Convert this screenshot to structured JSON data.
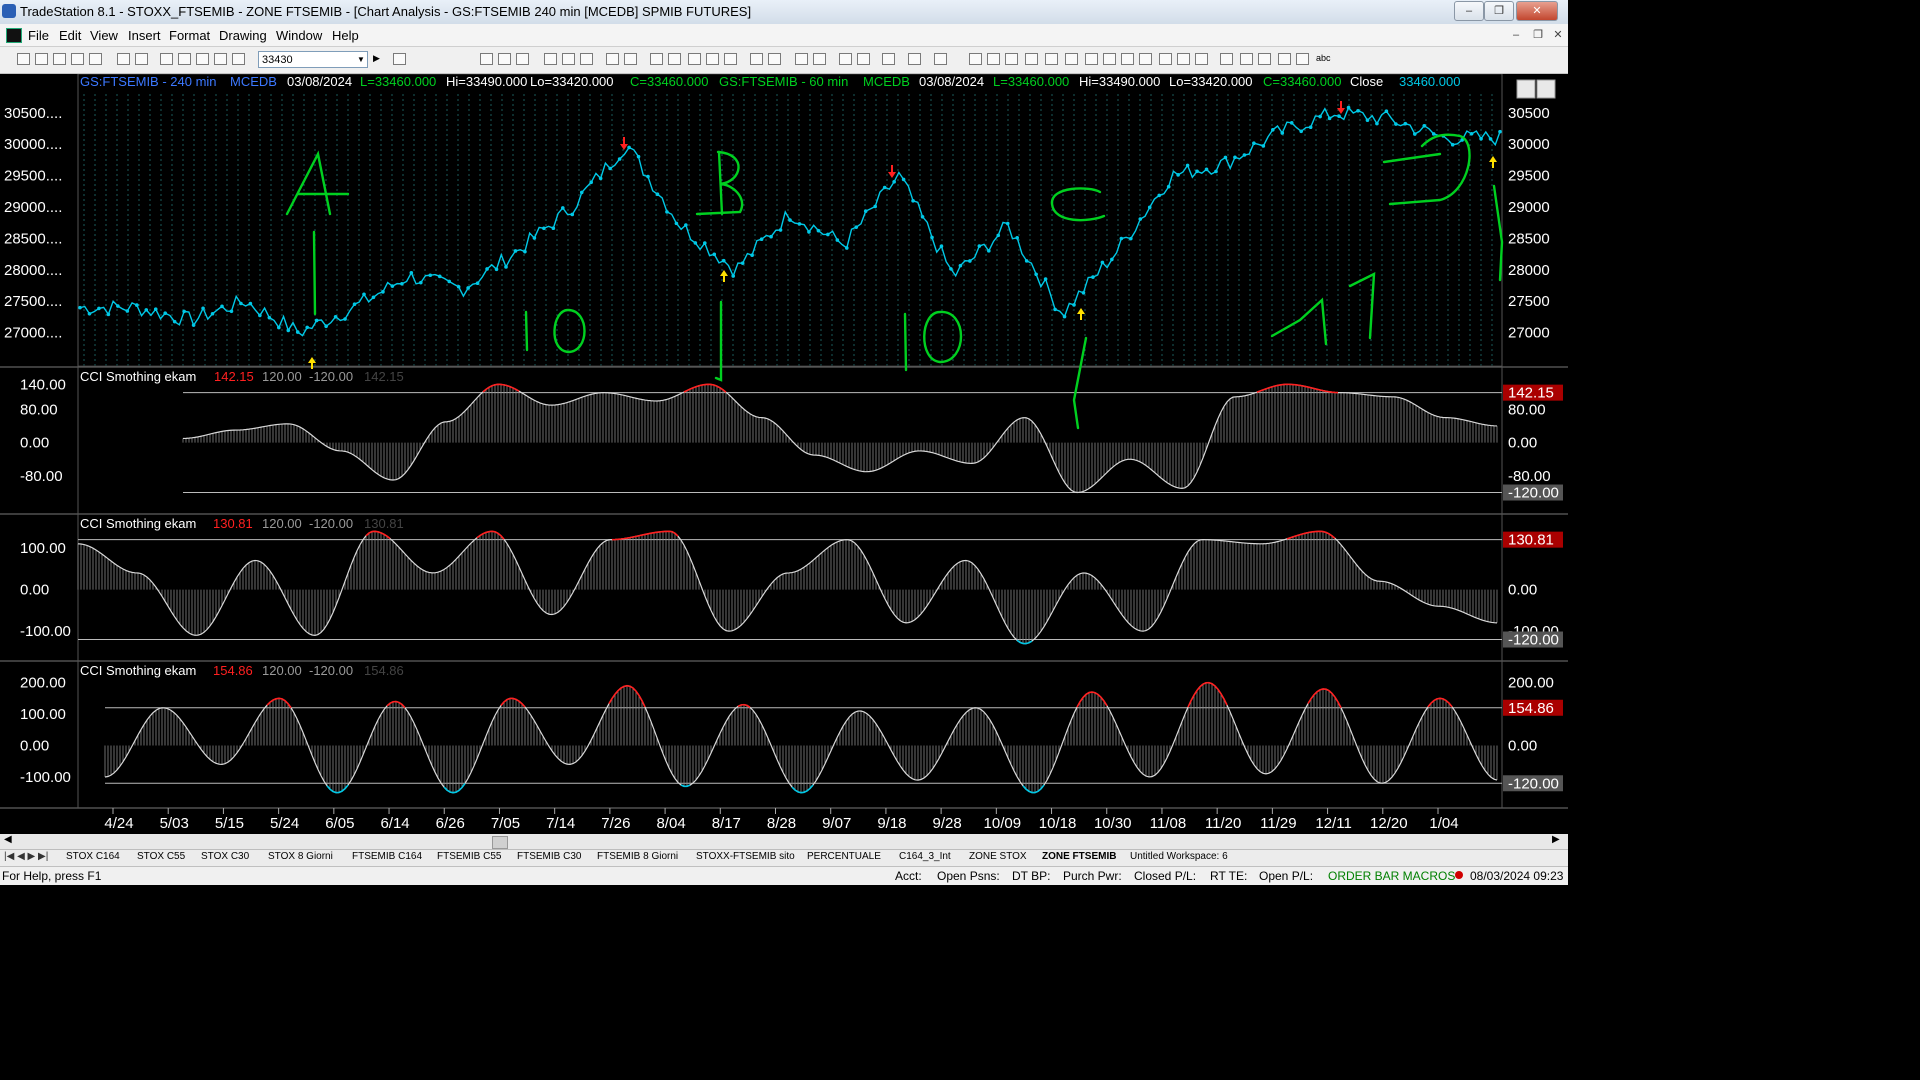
{
  "window": {
    "title": "TradeStation 8.1 - STOXX_FTSEMIB - ZONE FTSEMIB - [Chart Analysis - GS:FTSEMIB  240 min  [MCEDB] SPMIB FUTURES]",
    "min": "–",
    "max": "❐",
    "close": "✕"
  },
  "menu": [
    "File",
    "Edit",
    "View",
    "Insert",
    "Format",
    "Drawing",
    "Window",
    "Help"
  ],
  "toolbar": {
    "symbol_value": "33430"
  },
  "price_header": {
    "sym1": "GS:FTSEMIB - 240 min",
    "db1": "MCEDB",
    "date1": "03/08/2024",
    "l1": "L=33460.000",
    "h1": "Hi=33490.000",
    "lo1": "Lo=33420.000",
    "c1": "C=33460.000",
    "sym2": "GS:FTSEMIB - 60 min",
    "db2": "MCEDB",
    "date2": "03/08/2024",
    "l2": "L=33460.000",
    "h2": "Hi=33490.000",
    "lo2": "Lo=33420.000",
    "c2": "C=33460.000",
    "close_label": "Close",
    "close_val": "33460.000"
  },
  "price_axis": {
    "left": [
      "30500....",
      "30000....",
      "29500....",
      "29000....",
      "28500....",
      "28000....",
      "27500....",
      "27000...."
    ],
    "right": [
      "30500",
      "30000",
      "29500",
      "29000",
      "28500",
      "28000",
      "27500",
      "27000"
    ],
    "values": [
      30500,
      30000,
      29500,
      29000,
      28500,
      28000,
      27500,
      27000
    ]
  },
  "cci_panels": [
    {
      "name": "CCI Smothing ekam",
      "v": "142.15",
      "up": "120.00",
      "dn": "-120.00",
      "ghost": "142.15",
      "axis": [
        "140.00",
        "80.00",
        "0.00",
        "-80.00"
      ],
      "axis_vals": [
        140,
        80,
        0,
        -80
      ],
      "right": [
        "142.15",
        "80.00",
        "0.00",
        "-80.00",
        "-120.00"
      ],
      "right_vals": [
        120,
        80,
        0,
        -80,
        -120
      ]
    },
    {
      "name": "CCI Smothing ekam",
      "v": "130.81",
      "up": "120.00",
      "dn": "-120.00",
      "ghost": "130.81",
      "axis": [
        "100.00",
        "0.00",
        "-100.00"
      ],
      "axis_vals": [
        100,
        0,
        -100
      ],
      "right": [
        "130.81",
        "0.00",
        "-100.00",
        "-120.00"
      ],
      "right_vals": [
        120,
        0,
        -100,
        -120
      ]
    },
    {
      "name": "CCI Smothing ekam",
      "v": "154.86",
      "up": "120.00",
      "dn": "-120.00",
      "ghost": "154.86",
      "axis": [
        "200.00",
        "100.00",
        "0.00",
        "-100.00"
      ],
      "axis_vals": [
        200,
        100,
        0,
        -100
      ],
      "right": [
        "200.00",
        "154.86",
        "0.00",
        "-120.00"
      ],
      "right_vals": [
        200,
        120,
        0,
        -120
      ]
    }
  ],
  "date_axis": [
    "4/24",
    "5/03",
    "5/15",
    "5/24",
    "6/05",
    "6/14",
    "6/26",
    "7/05",
    "7/14",
    "7/26",
    "8/04",
    "8/17",
    "8/28",
    "9/07",
    "9/18",
    "9/28",
    "10/09",
    "10/18",
    "10/30",
    "11/08",
    "11/20",
    "11/29",
    "12/11",
    "12/20",
    "1/04"
  ],
  "annotations": {
    "a": "A",
    "b": "B",
    "c": "C",
    "d": "D",
    "n10a": "10",
    "n10b": "10",
    "n11": "11"
  },
  "workspace_tabs": [
    "STOX C164",
    "STOX C55",
    "STOX  C30",
    "STOX  8 Giorni",
    "FTSEMIB C164",
    "FTSEMIB C55",
    "FTSEMIB C30",
    "FTSEMIB  8 Giorni",
    "STOXX-FTSEMIB sito",
    "PERCENTUALE",
    "C164_3_Int",
    "ZONE STOX",
    "ZONE FTSEMIB",
    "Untitled Workspace:  6"
  ],
  "active_tab": "ZONE FTSEMIB",
  "status": {
    "help": "For Help, press F1",
    "acct": "Acct:",
    "open_psns": "Open Psns:",
    "dt_bp": "DT BP:",
    "purch_pwr": "Purch Pwr:",
    "closed_pl": "Closed P/L:",
    "rt_te": "RT TE:",
    "open_pl": "Open P/L:",
    "macros": "ORDER BAR  MACROS",
    "datetime": "08/03/2024 09:23"
  },
  "colors": {
    "price_line": "#00c8e6",
    "green_ink": "#00d020",
    "cci_pos_peak": "#ff2020",
    "cci_neg_trough": "#00c8e6",
    "header_blue": "#3c78ff",
    "header_green": "#00d020"
  },
  "chart_data": {
    "type": "line",
    "x": [
      "4/24",
      "5/03",
      "5/15",
      "5/24",
      "6/05",
      "6/14",
      "6/26",
      "7/05",
      "7/14",
      "7/26",
      "8/04",
      "8/17",
      "8/28",
      "9/07",
      "9/18",
      "9/28",
      "10/09",
      "10/18",
      "10/30",
      "11/08",
      "11/20",
      "11/29",
      "12/11",
      "12/20",
      "1/04"
    ],
    "series": [
      {
        "values": [
          27400,
          27200,
          27500,
          27000,
          27400,
          27900,
          27700,
          28300,
          29000,
          30000,
          28700,
          28000,
          28900,
          28400,
          29500,
          27900,
          28700,
          27300,
          28300,
          29500,
          29700,
          30200,
          30500,
          30400,
          30100
        ]
      }
    ],
    "ylim": [
      26500,
      30800
    ],
    "cci": [
      {
        "name": "CCI Smothing ekam",
        "last": 142.15,
        "bands": [
          120,
          -120
        ],
        "values": [
          10,
          30,
          45,
          -20,
          -90,
          50,
          140,
          90,
          120,
          100,
          140,
          60,
          -30,
          -70,
          -20,
          -50,
          60,
          -120,
          -40,
          -110,
          110,
          140,
          120,
          110,
          60,
          40
        ]
      },
      {
        "name": "CCI Smothing ekam",
        "last": 130.81,
        "bands": [
          120,
          -120
        ],
        "values": [
          110,
          40,
          -110,
          70,
          -110,
          140,
          40,
          140,
          -60,
          120,
          140,
          -100,
          40,
          120,
          -80,
          70,
          -130,
          40,
          -100,
          120,
          110,
          140,
          20,
          -40,
          -80
        ]
      },
      {
        "name": "CCI Smothing ekam",
        "last": 154.86,
        "bands": [
          120,
          -120
        ],
        "values": [
          -100,
          120,
          -60,
          150,
          -150,
          140,
          -150,
          150,
          -60,
          190,
          -130,
          130,
          -150,
          110,
          -110,
          120,
          -150,
          170,
          -100,
          200,
          -90,
          180,
          -120,
          150,
          -110
        ]
      }
    ]
  }
}
